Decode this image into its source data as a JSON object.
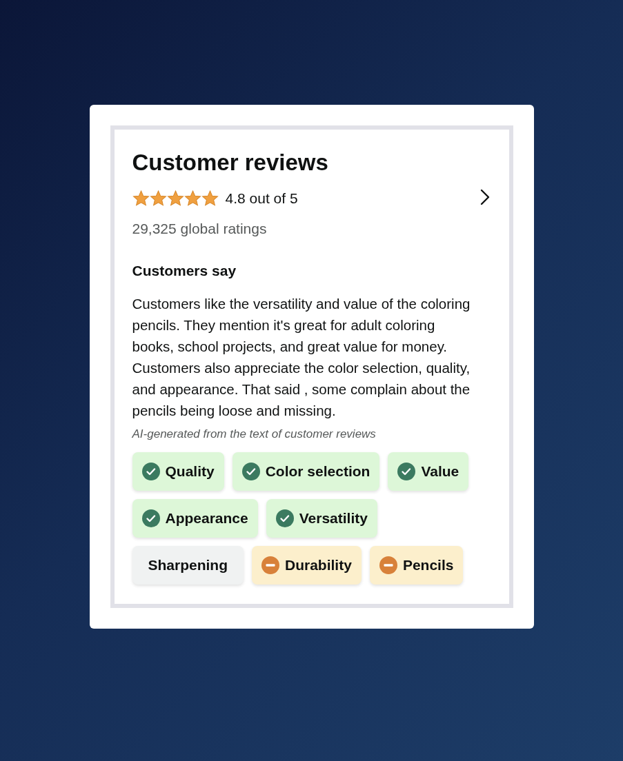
{
  "title": "Customer reviews",
  "rating": {
    "stars": 5,
    "text": "4.8 out of 5"
  },
  "global_ratings": "29,325 global ratings",
  "customers_say": {
    "heading": "Customers say",
    "summary": "Customers like the versatility and value of the coloring pencils. They mention it's great for adult coloring books, school projects, and great value for money. Customers also appreciate the color selection, quality, and appearance. That said , some complain about the pencils being loose and missing.",
    "note": "AI-generated from the text of customer reviews"
  },
  "aspects": [
    {
      "label": "Quality",
      "kind": "positive"
    },
    {
      "label": "Color selection",
      "kind": "positive"
    },
    {
      "label": "Value",
      "kind": "positive"
    },
    {
      "label": "Appearance",
      "kind": "positive"
    },
    {
      "label": "Versatility",
      "kind": "positive"
    },
    {
      "label": "Sharpening",
      "kind": "neutral"
    },
    {
      "label": "Durability",
      "kind": "negative"
    },
    {
      "label": "Pencils",
      "kind": "negative"
    }
  ]
}
